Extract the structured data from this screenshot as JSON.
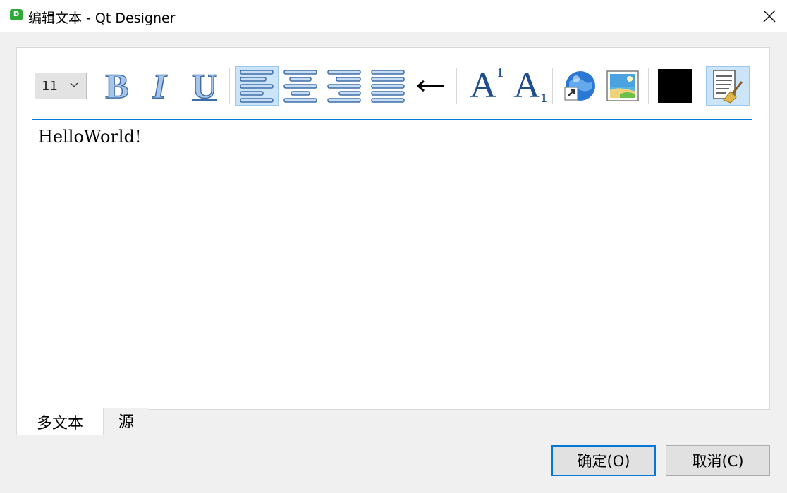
{
  "window": {
    "app_icon_letter": "D",
    "title": "编辑文本 - Qt Designer",
    "close_icon": "close-icon"
  },
  "toolbar": {
    "font_size": "11",
    "bold_label": "B",
    "italic_label": "I",
    "underline_label": "U",
    "superscript_base": "A",
    "superscript_index": "1",
    "subscript_base": "A",
    "subscript_index": "1",
    "text_color": "#000000",
    "icons": [
      "bold-icon",
      "italic-icon",
      "underline-icon",
      "align-left-icon",
      "align-center-icon",
      "align-right-icon",
      "justify-icon",
      "right-to-left-icon",
      "superscript-icon",
      "subscript-icon",
      "insert-link-icon",
      "insert-image-icon",
      "text-color-icon",
      "simplify-rich-text-icon"
    ]
  },
  "editor": {
    "content": "HelloWorld!"
  },
  "tabs": {
    "rich_text": "多文本",
    "source": "源"
  },
  "buttons": {
    "ok": "确定(O)",
    "cancel": "取消(C)"
  },
  "colors": {
    "accent": "#0078d7",
    "active_toggle": "#cce4f7"
  }
}
